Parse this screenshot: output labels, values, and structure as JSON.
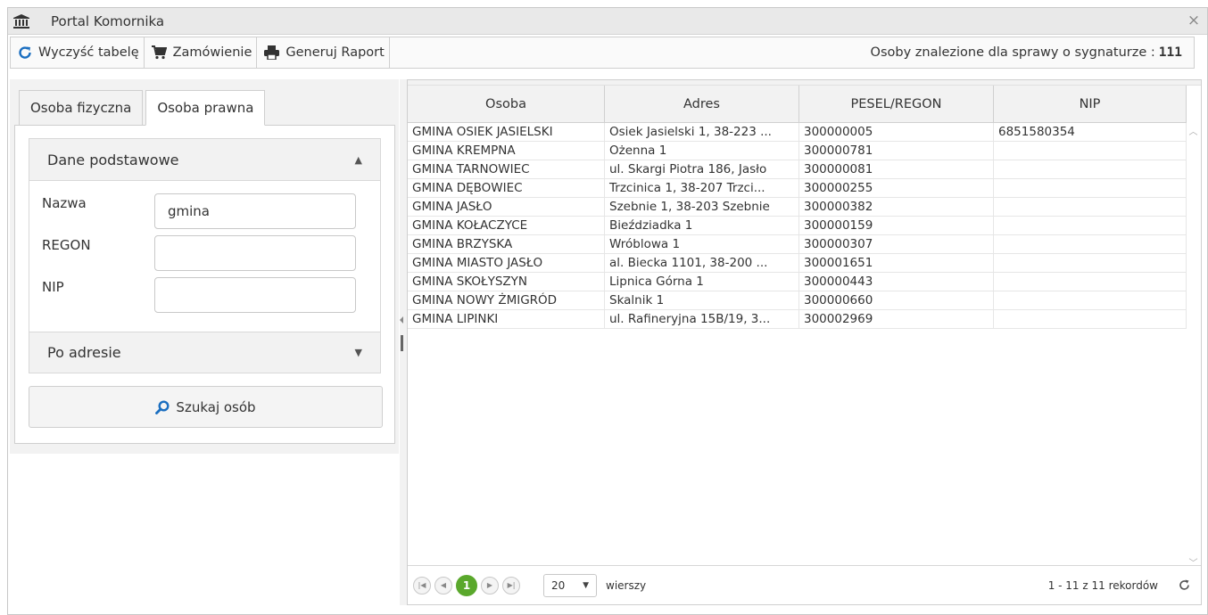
{
  "window": {
    "title": "Portal Komornika",
    "close_symbol": "×"
  },
  "toolbar": {
    "clear_label": "Wyczyść tabelę",
    "order_label": "Zamówienie",
    "report_label": "Generuj Raport",
    "info_text": "Osoby znalezione dla sprawy o sygnaturze :",
    "signature": "111"
  },
  "tabs": [
    {
      "label": "Osoba fizyczna",
      "active": false
    },
    {
      "label": "Osoba prawna",
      "active": true
    }
  ],
  "basic_section": {
    "title": "Dane podstawowe",
    "arrow": "▲",
    "fields": [
      {
        "label": "Nazwa",
        "value": "gmina"
      },
      {
        "label": "REGON",
        "value": ""
      },
      {
        "label": "NIP",
        "value": ""
      }
    ]
  },
  "address_section": {
    "title": "Po adresie",
    "arrow": "▼"
  },
  "search_button": {
    "label": "Szukaj osób"
  },
  "grid": {
    "columns": [
      "Osoba",
      "Adres",
      "PESEL/REGON",
      "NIP"
    ],
    "rows": [
      [
        "GMINA OSIEK JASIELSKI",
        "Osiek Jasielski 1, 38-223 ...",
        "300000005",
        "6851580354"
      ],
      [
        "GMINA KREMPNA",
        "Ożenna 1",
        "300000781",
        ""
      ],
      [
        "GMINA TARNOWIEC",
        "ul. Skargi Piotra 186, Jasło",
        "300000081",
        ""
      ],
      [
        "GMINA DĘBOWIEC",
        "Trzcinica 1, 38-207 Trzci...",
        "300000255",
        ""
      ],
      [
        "GMINA JASŁO",
        "Szebnie 1, 38-203 Szebnie",
        "300000382",
        ""
      ],
      [
        "GMINA KOŁACZYCE",
        "Bieździadka 1",
        "300000159",
        ""
      ],
      [
        "GMINA BRZYSKA",
        "Wróblowa 1",
        "300000307",
        ""
      ],
      [
        "GMINA MIASTO JASŁO",
        "al. Biecka 1101, 38-200 ...",
        "300001651",
        ""
      ],
      [
        "GMINA SKOŁYSZYN",
        "Lipnica Górna 1",
        "300000443",
        ""
      ],
      [
        "GMINA NOWY ŻMIGRÓD",
        "Skalnik 1",
        "300000660",
        ""
      ],
      [
        "GMINA LIPINKI",
        "ul. Rafineryjna 15B/19, 3...",
        "300002969",
        ""
      ]
    ]
  },
  "pager": {
    "first_icon": "first-page-icon",
    "prev_icon": "prev-page-icon",
    "current_page": "1",
    "next_icon": "next-page-icon",
    "last_icon": "last-page-icon",
    "page_size": "20",
    "page_size_suffix": "wierszy",
    "summary": "1 - 11 z 11 rekordów"
  },
  "colors": {
    "accent_green": "#5aa82c",
    "refresh_blue": "#1a6ec0"
  }
}
